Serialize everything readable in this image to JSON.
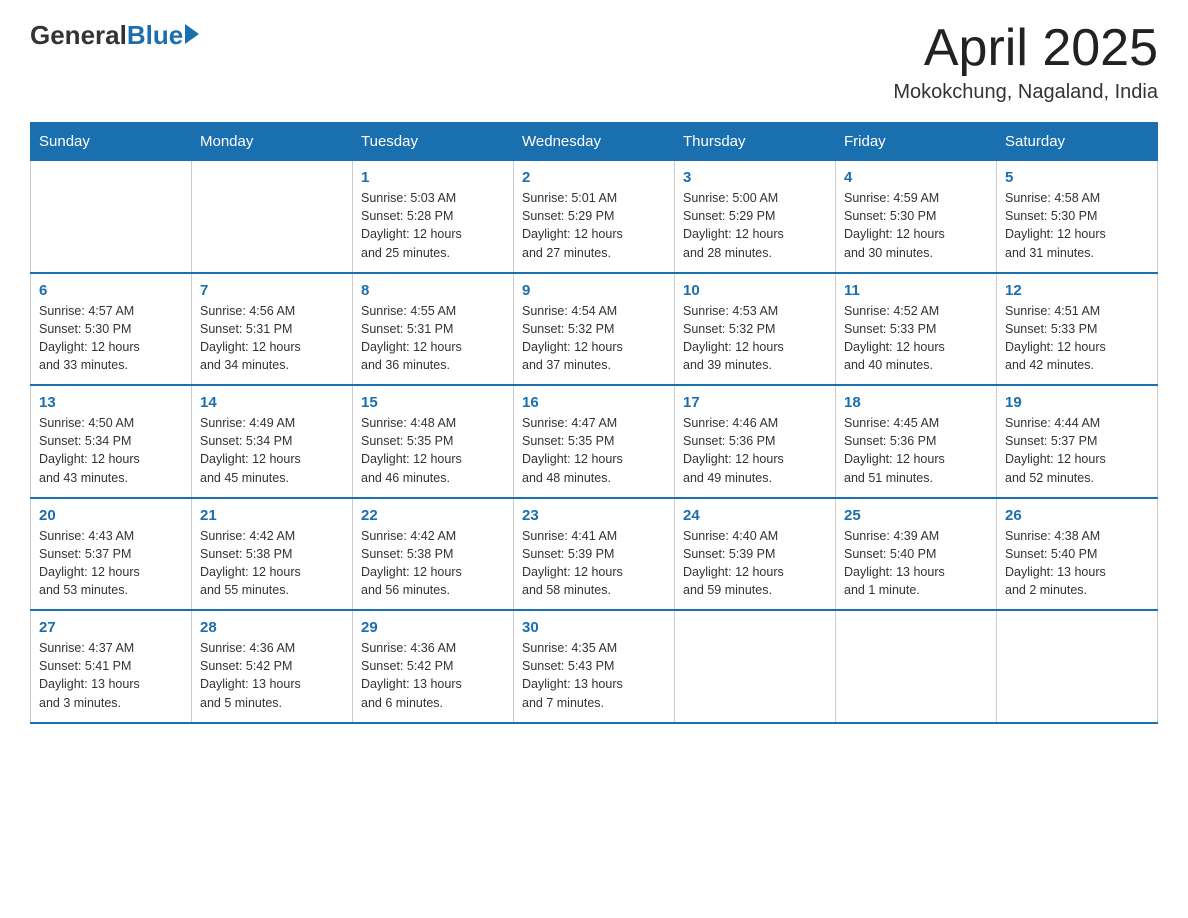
{
  "header": {
    "logo_general": "General",
    "logo_blue": "Blue",
    "month_title": "April 2025",
    "location": "Mokokchung, Nagaland, India"
  },
  "days_of_week": [
    "Sunday",
    "Monday",
    "Tuesday",
    "Wednesday",
    "Thursday",
    "Friday",
    "Saturday"
  ],
  "weeks": [
    [
      {
        "day": "",
        "info": ""
      },
      {
        "day": "",
        "info": ""
      },
      {
        "day": "1",
        "info": "Sunrise: 5:03 AM\nSunset: 5:28 PM\nDaylight: 12 hours\nand 25 minutes."
      },
      {
        "day": "2",
        "info": "Sunrise: 5:01 AM\nSunset: 5:29 PM\nDaylight: 12 hours\nand 27 minutes."
      },
      {
        "day": "3",
        "info": "Sunrise: 5:00 AM\nSunset: 5:29 PM\nDaylight: 12 hours\nand 28 minutes."
      },
      {
        "day": "4",
        "info": "Sunrise: 4:59 AM\nSunset: 5:30 PM\nDaylight: 12 hours\nand 30 minutes."
      },
      {
        "day": "5",
        "info": "Sunrise: 4:58 AM\nSunset: 5:30 PM\nDaylight: 12 hours\nand 31 minutes."
      }
    ],
    [
      {
        "day": "6",
        "info": "Sunrise: 4:57 AM\nSunset: 5:30 PM\nDaylight: 12 hours\nand 33 minutes."
      },
      {
        "day": "7",
        "info": "Sunrise: 4:56 AM\nSunset: 5:31 PM\nDaylight: 12 hours\nand 34 minutes."
      },
      {
        "day": "8",
        "info": "Sunrise: 4:55 AM\nSunset: 5:31 PM\nDaylight: 12 hours\nand 36 minutes."
      },
      {
        "day": "9",
        "info": "Sunrise: 4:54 AM\nSunset: 5:32 PM\nDaylight: 12 hours\nand 37 minutes."
      },
      {
        "day": "10",
        "info": "Sunrise: 4:53 AM\nSunset: 5:32 PM\nDaylight: 12 hours\nand 39 minutes."
      },
      {
        "day": "11",
        "info": "Sunrise: 4:52 AM\nSunset: 5:33 PM\nDaylight: 12 hours\nand 40 minutes."
      },
      {
        "day": "12",
        "info": "Sunrise: 4:51 AM\nSunset: 5:33 PM\nDaylight: 12 hours\nand 42 minutes."
      }
    ],
    [
      {
        "day": "13",
        "info": "Sunrise: 4:50 AM\nSunset: 5:34 PM\nDaylight: 12 hours\nand 43 minutes."
      },
      {
        "day": "14",
        "info": "Sunrise: 4:49 AM\nSunset: 5:34 PM\nDaylight: 12 hours\nand 45 minutes."
      },
      {
        "day": "15",
        "info": "Sunrise: 4:48 AM\nSunset: 5:35 PM\nDaylight: 12 hours\nand 46 minutes."
      },
      {
        "day": "16",
        "info": "Sunrise: 4:47 AM\nSunset: 5:35 PM\nDaylight: 12 hours\nand 48 minutes."
      },
      {
        "day": "17",
        "info": "Sunrise: 4:46 AM\nSunset: 5:36 PM\nDaylight: 12 hours\nand 49 minutes."
      },
      {
        "day": "18",
        "info": "Sunrise: 4:45 AM\nSunset: 5:36 PM\nDaylight: 12 hours\nand 51 minutes."
      },
      {
        "day": "19",
        "info": "Sunrise: 4:44 AM\nSunset: 5:37 PM\nDaylight: 12 hours\nand 52 minutes."
      }
    ],
    [
      {
        "day": "20",
        "info": "Sunrise: 4:43 AM\nSunset: 5:37 PM\nDaylight: 12 hours\nand 53 minutes."
      },
      {
        "day": "21",
        "info": "Sunrise: 4:42 AM\nSunset: 5:38 PM\nDaylight: 12 hours\nand 55 minutes."
      },
      {
        "day": "22",
        "info": "Sunrise: 4:42 AM\nSunset: 5:38 PM\nDaylight: 12 hours\nand 56 minutes."
      },
      {
        "day": "23",
        "info": "Sunrise: 4:41 AM\nSunset: 5:39 PM\nDaylight: 12 hours\nand 58 minutes."
      },
      {
        "day": "24",
        "info": "Sunrise: 4:40 AM\nSunset: 5:39 PM\nDaylight: 12 hours\nand 59 minutes."
      },
      {
        "day": "25",
        "info": "Sunrise: 4:39 AM\nSunset: 5:40 PM\nDaylight: 13 hours\nand 1 minute."
      },
      {
        "day": "26",
        "info": "Sunrise: 4:38 AM\nSunset: 5:40 PM\nDaylight: 13 hours\nand 2 minutes."
      }
    ],
    [
      {
        "day": "27",
        "info": "Sunrise: 4:37 AM\nSunset: 5:41 PM\nDaylight: 13 hours\nand 3 minutes."
      },
      {
        "day": "28",
        "info": "Sunrise: 4:36 AM\nSunset: 5:42 PM\nDaylight: 13 hours\nand 5 minutes."
      },
      {
        "day": "29",
        "info": "Sunrise: 4:36 AM\nSunset: 5:42 PM\nDaylight: 13 hours\nand 6 minutes."
      },
      {
        "day": "30",
        "info": "Sunrise: 4:35 AM\nSunset: 5:43 PM\nDaylight: 13 hours\nand 7 minutes."
      },
      {
        "day": "",
        "info": ""
      },
      {
        "day": "",
        "info": ""
      },
      {
        "day": "",
        "info": ""
      }
    ]
  ]
}
